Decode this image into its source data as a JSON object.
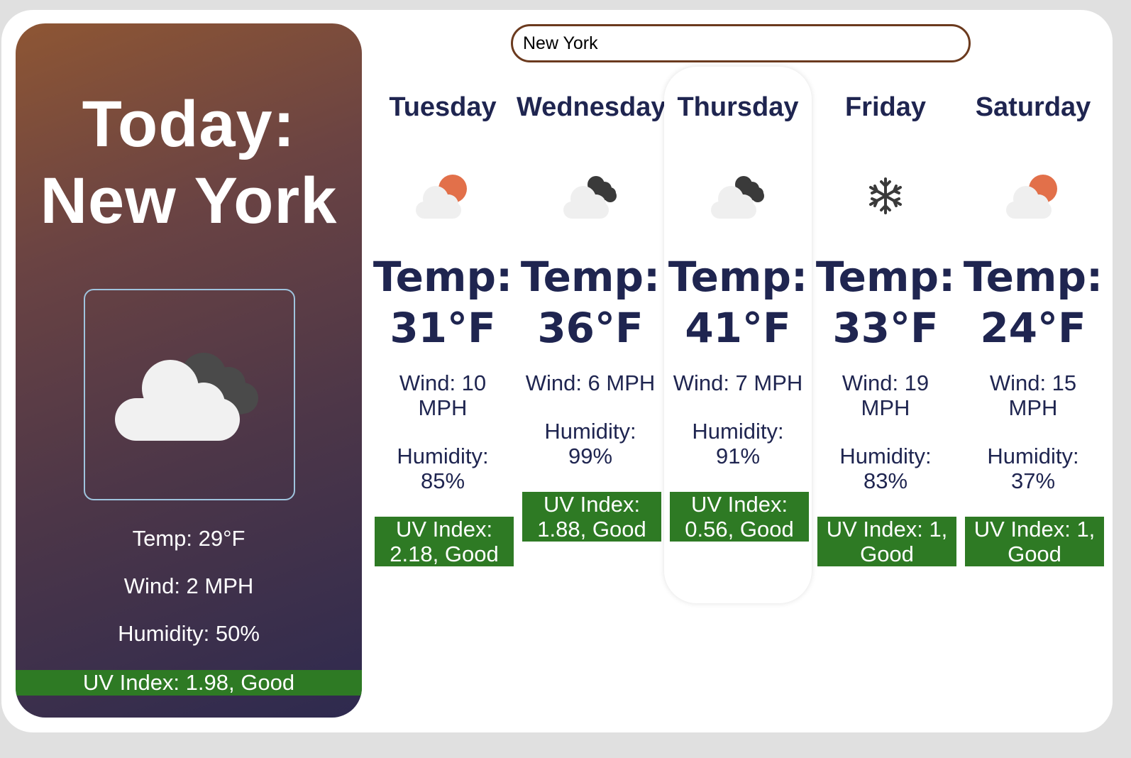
{
  "search": {
    "value": "New York"
  },
  "today": {
    "heading": "Today:",
    "city": "New York",
    "icon": "cloudy-icon",
    "temp": "Temp: 29°F",
    "wind": "Wind: 2 MPH",
    "humidity": "Humidity: 50%",
    "uv": "UV Index: 1.98, Good"
  },
  "forecast": [
    {
      "day": "Tuesday",
      "icon": "partly-cloudy-day-icon",
      "temp_label": "Temp:",
      "temp": "31°F",
      "wind_label": "Wind: 10",
      "wind_unit": "MPH",
      "humidity_label": "Humidity:",
      "humidity": "85%",
      "uv_1": "UV Index:",
      "uv_2": "2.18, Good"
    },
    {
      "day": "Wednesday",
      "icon": "cloudy-icon",
      "temp_label": "Temp:",
      "temp": "36°F",
      "wind_label": "Wind: 6 MPH",
      "wind_unit": "",
      "humidity_label": "Humidity:",
      "humidity": "99%",
      "uv_1": "UV Index:",
      "uv_2": "1.88, Good"
    },
    {
      "day": "Thursday",
      "icon": "cloudy-icon",
      "temp_label": "Temp:",
      "temp": "41°F",
      "wind_label": "Wind: 7 MPH",
      "wind_unit": "",
      "humidity_label": "Humidity:",
      "humidity": "91%",
      "uv_1": "UV Index:",
      "uv_2": "0.56, Good"
    },
    {
      "day": "Friday",
      "icon": "snow-icon",
      "temp_label": "Temp:",
      "temp": "33°F",
      "wind_label": "Wind: 19",
      "wind_unit": "MPH",
      "humidity_label": "Humidity:",
      "humidity": "83%",
      "uv_1": "UV Index: 1,",
      "uv_2": "Good"
    },
    {
      "day": "Saturday",
      "icon": "partly-cloudy-day-icon",
      "temp_label": "Temp:",
      "temp": "24°F",
      "wind_label": "Wind: 15",
      "wind_unit": "MPH",
      "humidity_label": "Humidity:",
      "humidity": "37%",
      "uv_1": "UV Index: 1,",
      "uv_2": "Good"
    }
  ],
  "colors": {
    "uv_good": "#2e7a24",
    "text_dark": "#1f2550",
    "search_border": "#6b3a1e",
    "sun": "#e2704a"
  }
}
